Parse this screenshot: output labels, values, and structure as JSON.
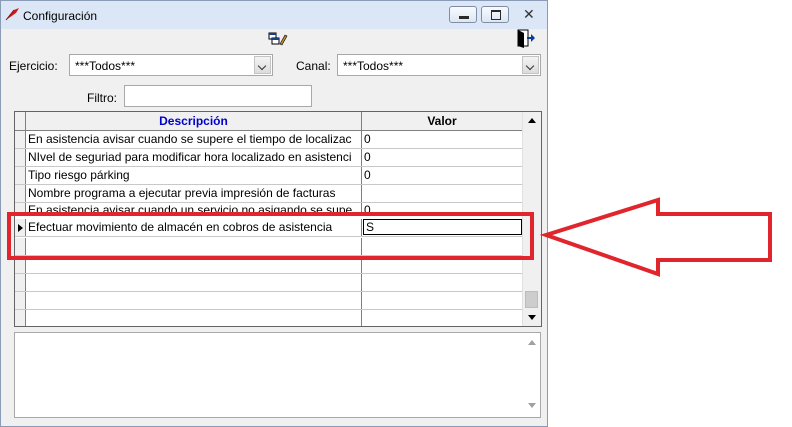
{
  "window": {
    "title": "Configuración",
    "close_glyph": "✕"
  },
  "toolbar": {
    "icons": [
      "edit-form-icon",
      "exit-door-icon"
    ]
  },
  "filters": {
    "ejercicio_label": "Ejercicio:",
    "ejercicio_value": "***Todos***",
    "canal_label": "Canal:",
    "canal_value": "***Todos***",
    "filtro_label": "Filtro:",
    "filtro_value": ""
  },
  "grid": {
    "columns": [
      "Descripción",
      "Valor"
    ],
    "rows": [
      {
        "descripcion": "En asistencia avisar cuando se supere el tiempo de localizac",
        "valor": "0"
      },
      {
        "descripcion": "NIvel de seguriad para modificar hora localizado en asistenci",
        "valor": "0"
      },
      {
        "descripcion": "Tipo riesgo párking",
        "valor": "0"
      },
      {
        "descripcion": "Nombre programa a ejecutar previa impresión de facturas",
        "valor": ""
      },
      {
        "descripcion": "En asistencia avisar cuando un servicio no asigando se supe",
        "valor": "0"
      },
      {
        "descripcion": "Efectuar movimiento de almacén en cobros de asistencia",
        "valor": "S"
      }
    ]
  },
  "memo": {
    "text": ""
  },
  "annotation": {
    "color": "#e0262c"
  }
}
